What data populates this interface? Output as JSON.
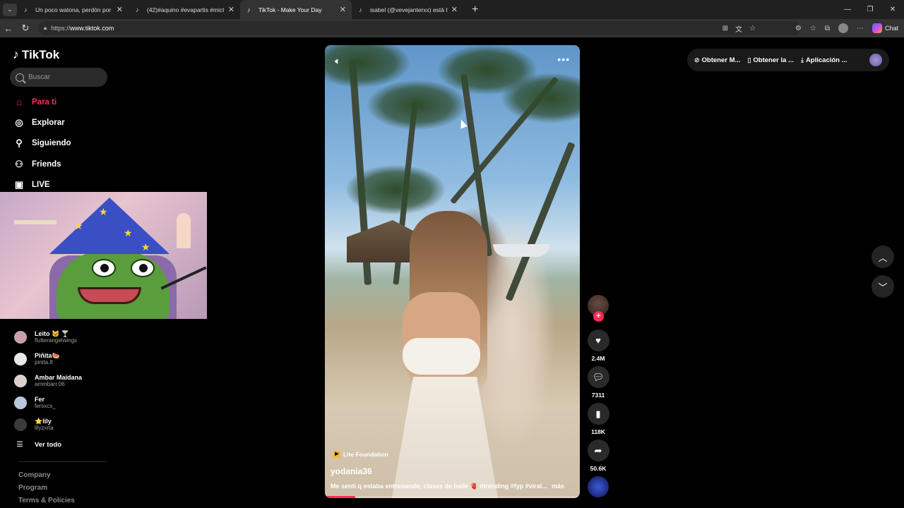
{
  "browser": {
    "tabs": [
      {
        "title": "Un poco watona, perdón por las e",
        "active": false
      },
      {
        "title": "(42)#aquino #evapartis #mictia00",
        "active": false
      },
      {
        "title": "TikTok - Make Your Day",
        "active": true
      },
      {
        "title": "isabel (@vevejanterxx) está LIVE: T",
        "active": false
      }
    ],
    "url_scheme": "https://",
    "url_host": "www.tiktok.com",
    "chat_label": "Chat"
  },
  "sidebar": {
    "logo": "TikTok",
    "search_placeholder": "Buscar",
    "nav": [
      {
        "label": "Para ti",
        "icon": "home-icon",
        "active": true
      },
      {
        "label": "Explorar",
        "icon": "compass-icon",
        "active": false
      },
      {
        "label": "Siguiendo",
        "icon": "following-icon",
        "active": false
      },
      {
        "label": "Friends",
        "icon": "friends-icon",
        "active": false
      },
      {
        "label": "LIVE",
        "icon": "live-icon",
        "active": false
      }
    ],
    "following": [
      {
        "name": "Leito 🐱 🍸",
        "handle": "flutterangelwings",
        "avatar_color": "#c9a0a8"
      },
      {
        "name": "Piñita🍉",
        "handle": "pinita.8",
        "avatar_color": "#e8e8e8"
      },
      {
        "name": "Ambar Maidana",
        "handle": "ammbarr.06",
        "avatar_color": "#d9d2cc"
      },
      {
        "name": "Fer",
        "handle": "fersxcs_",
        "avatar_color": "#b8c7d9"
      },
      {
        "name": "⭐lily",
        "handle": "lilyzxrta",
        "avatar_color": "#3b3b3b"
      }
    ],
    "see_all": "Ver todo",
    "footer": [
      "Company",
      "Program",
      "Terms & Policies"
    ]
  },
  "video": {
    "badge": "Lite Foundation",
    "author": "yodania36",
    "caption": "Me sentí q estaba entrenando, clases de baile 🫀 #trending #fyp #viral...",
    "more": "más",
    "progress": 0.12
  },
  "actions": {
    "likes": "2.4M",
    "comments": "7311",
    "saves": "118K",
    "shares": "50.6K"
  },
  "header": {
    "btn1": "Obtener M...",
    "btn2": "Obtener la ...",
    "btn3": "Aplicación ..."
  }
}
